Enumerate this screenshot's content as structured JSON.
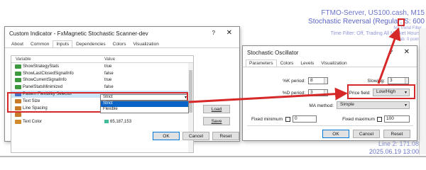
{
  "chart_overlay": {
    "server": "FTMO-Server, US100.cash, M15",
    "reversal": "Stochastic Reversal (Regular: S: 600",
    "no_trend": "No Trend Filter",
    "time_filter": "Time Filter: Off, Trading All Market Hours.",
    "points": "ab: 0 points",
    "date_line1": "Line 2: 171.08",
    "date_line2": "2025.06.19 13:00"
  },
  "dialog1": {
    "title": "Custom Indicator - FxMagnetic Stochastic Scanner-dev",
    "help": "?",
    "close": "✕",
    "tabs": [
      "About",
      "Common",
      "Inputs",
      "Dependencies",
      "Colors",
      "Visualization"
    ],
    "active_tab": "Inputs",
    "columns": [
      "Variable",
      "Value"
    ],
    "rows": [
      {
        "name": "ShowStrategyStats",
        "value": "true",
        "type": "bool"
      },
      {
        "name": "ShowLastClosedSignalInfo",
        "value": "false",
        "type": "bool"
      },
      {
        "name": "ShowCurrentSignalInfo",
        "value": "true",
        "type": "bool"
      },
      {
        "name": "PanelStatsMinimized",
        "value": "false",
        "type": "bool"
      },
      {
        "name": "Pattern Flexibility Selector",
        "value": "Strict",
        "type": "list"
      },
      {
        "name": "Text Size",
        "value": "",
        "type": "int"
      },
      {
        "name": "Line Spacing",
        "value": "",
        "type": "int"
      },
      {
        "name": "",
        "value": "",
        "type": "int"
      },
      {
        "name": "Text Color",
        "value": "65,187,153",
        "type": "color"
      }
    ],
    "dropdown_options": [
      "Strict",
      "Flexible"
    ],
    "dropdown_selected": "Strict",
    "buttons": {
      "load": "Load",
      "save": "Save",
      "ok": "OK",
      "cancel": "Cancel",
      "reset": "Reset"
    }
  },
  "dialog2": {
    "title": "Stochastic Oscillator",
    "help": "?",
    "close": "✕",
    "tabs": [
      "Parameters",
      "Colors",
      "Levels",
      "Visualization"
    ],
    "active_tab": "Parameters",
    "k_period_label": "%K period:",
    "k_period": "8",
    "d_period_label": "%D period:",
    "d_period": "3",
    "slowing_label": "Slowing:",
    "slowing": "3",
    "price_field_label": "Price field:",
    "price_field": "Low/High",
    "ma_method_label": "MA method:",
    "ma_method": "Simple",
    "fixed_min_label": "Fixed minimum",
    "fixed_min": "0",
    "fixed_max_label": "Fixed maximum",
    "fixed_max": "100",
    "buttons": {
      "ok": "OK",
      "cancel": "Cancel",
      "reset": "Reset"
    }
  },
  "colors": {
    "highlight": "#d62828",
    "selection": "#0a64c8",
    "text_color_swatch": "#41bb99"
  }
}
